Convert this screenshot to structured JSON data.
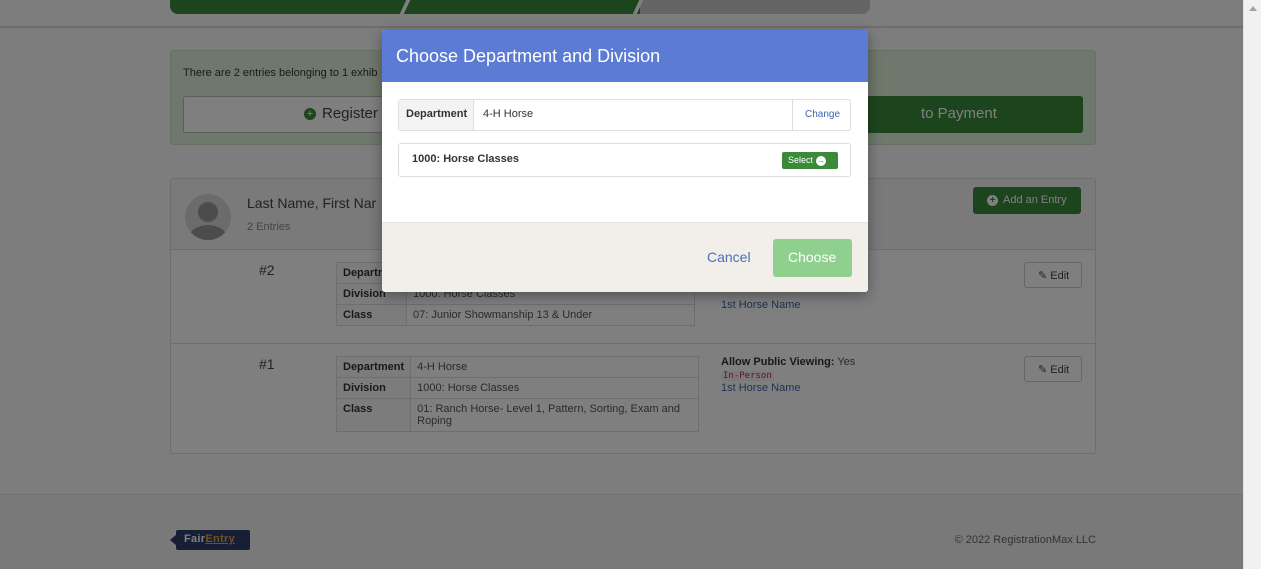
{
  "info": {
    "entries_text": "There are 2 entries belonging to 1 exhib",
    "register_label": "Register a",
    "payment_label": "to Payment"
  },
  "exhibitor": {
    "name": "Last Name, First Nar",
    "entry_count": "2 Entries",
    "add_entry_label": "Add an Entry"
  },
  "entries": [
    {
      "number": "#2",
      "department_label": "Departm",
      "division_label": "Division",
      "division_value": "1000: Horse Classes",
      "class_label": "Class",
      "class_value": "07: Junior Showmanship 13 & Under",
      "horse_name": "1st Horse Name",
      "edit_label": "Edit"
    },
    {
      "number": "#1",
      "department_label": "Department",
      "department_value": "4-H Horse",
      "division_label": "Division",
      "division_value": "1000: Horse Classes",
      "class_label": "Class",
      "class_value": "01: Ranch Horse- Level 1, Pattern, Sorting, Exam and Roping",
      "public_viewing_label": "Allow Public Viewing:",
      "public_viewing_value": "Yes",
      "tag": "In-Person",
      "horse_name": "1st Horse Name",
      "edit_label": "Edit"
    }
  ],
  "footer": {
    "logo_text_1": "Fair",
    "logo_text_2": "Entry",
    "copyright": "© 2022 RegistrationMax LLC"
  },
  "modal": {
    "title": "Choose Department and Division",
    "department_label": "Department",
    "department_value": "4-H Horse",
    "change_label": "Change",
    "division": "1000: Horse Classes",
    "select_label": "Select",
    "cancel_label": "Cancel",
    "choose_label": "Choose"
  },
  "colors": {
    "modal_header": "#5b7bd5",
    "primary_green": "#3a8a3a",
    "choose_disabled": "#8fd08f",
    "info_panel": "#dff0d8"
  }
}
